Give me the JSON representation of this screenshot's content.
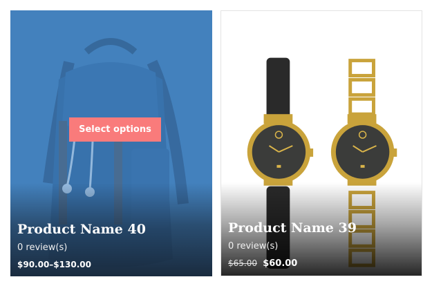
{
  "products": [
    {
      "title": "Product Name 40",
      "reviews": "0 review(s)",
      "price": "$90.00–$130.00",
      "button_label": "Select options",
      "image": "backpack"
    },
    {
      "title": "Product Name 39",
      "reviews": "0 review(s)",
      "price_old": "$65.00",
      "price_new": "$60.00",
      "image": "watches"
    }
  ],
  "colors": {
    "backpack_overlay": "#5492ce",
    "button": "#f97b7b",
    "text": "#ffffff"
  }
}
